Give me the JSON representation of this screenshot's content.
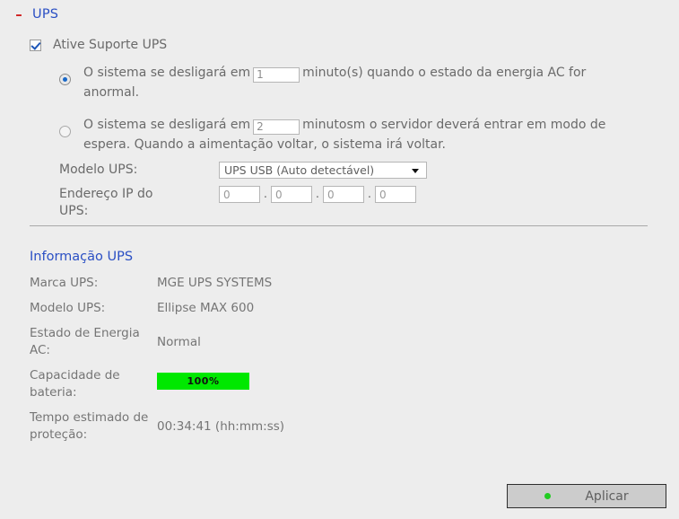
{
  "section": {
    "collapse_icon": "minus-icon",
    "collapse_glyph": "–",
    "title": "UPS",
    "title_color": "#2a4fc4"
  },
  "settings": {
    "enable": {
      "label": "Ative Suporte UPS",
      "checked": true
    },
    "options": [
      {
        "selected": true,
        "text_before": "O sistema se desligará em",
        "value": "1",
        "text_after": "minuto(s) quando o estado da energia AC for anormal."
      },
      {
        "selected": false,
        "text_before": "O sistema se desligará em",
        "value": "2",
        "text_after": "minutosm o servidor deverá entrar em modo de espera. Quando a aimentação voltar, o sistema irá voltar."
      }
    ],
    "model": {
      "label": "Modelo UPS:",
      "selected": "UPS USB (Auto detectável)"
    },
    "ip": {
      "label": "Endereço IP do UPS:",
      "octets": [
        "0",
        "0",
        "0",
        "0"
      ],
      "separator": "."
    }
  },
  "info": {
    "title": "Informação UPS",
    "rows": [
      {
        "label": "Marca UPS:",
        "value": "MGE UPS SYSTEMS"
      },
      {
        "label": "Modelo UPS:",
        "value": "Ellipse MAX 600"
      },
      {
        "label": "Estado de Energia AC:",
        "value": "Normal"
      }
    ],
    "battery": {
      "label": "Capacidade de bateria:",
      "percent_text": "100%",
      "percent": 100,
      "bar_color": "#00e800"
    },
    "runtime": {
      "label": "Tempo estimado de proteção:",
      "value": "00:34:41 (hh:mm:ss)"
    }
  },
  "footer": {
    "apply_label": "Aplicar",
    "apply_icon": "green-dot-icon",
    "apply_icon_color": "#22cc22"
  }
}
